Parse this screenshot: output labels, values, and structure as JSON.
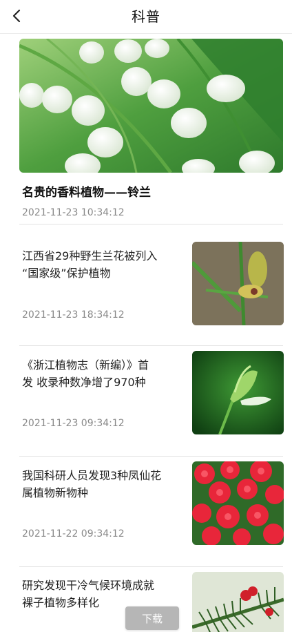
{
  "header": {
    "title": "科普",
    "back_icon": "chevron-left-icon"
  },
  "hero": {
    "title": "名贵的香料植物——铃兰",
    "date": "2021-11-23 10:34:12"
  },
  "articles": [
    {
      "title": "江西省29种野生兰花被列入\n“国家级”保护植物",
      "date": "2021-11-23 18:34:12"
    },
    {
      "title": "《浙江植物志（新编）》首\n发 收录种数净增了970种",
      "date": "2021-11-23 09:34:12"
    },
    {
      "title": "我国科研人员发现3种凤仙花\n属植物新物种",
      "date": "2021-11-22 09:34:12"
    },
    {
      "title": "研究发现干冷气候环境成就\n裸子植物多样化",
      "date": ""
    }
  ],
  "download_label": "下载",
  "colors": {
    "accent_green": "#3c9a3a",
    "divider": "#e2e2e2",
    "date_gray": "#888888"
  }
}
